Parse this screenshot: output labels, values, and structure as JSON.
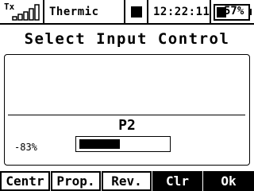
{
  "status": {
    "tx_label": "Tx",
    "model_name": "Thermic",
    "clock": "12:22:11",
    "battery_text": "57%",
    "battery_percent": 57
  },
  "title": "Select Input Control",
  "control": {
    "name": "P2",
    "value_text": "-83%",
    "level_fraction": 0.46
  },
  "softkeys": [
    "Centr",
    "Prop.",
    "Rev.",
    "Clr",
    "Ok"
  ]
}
